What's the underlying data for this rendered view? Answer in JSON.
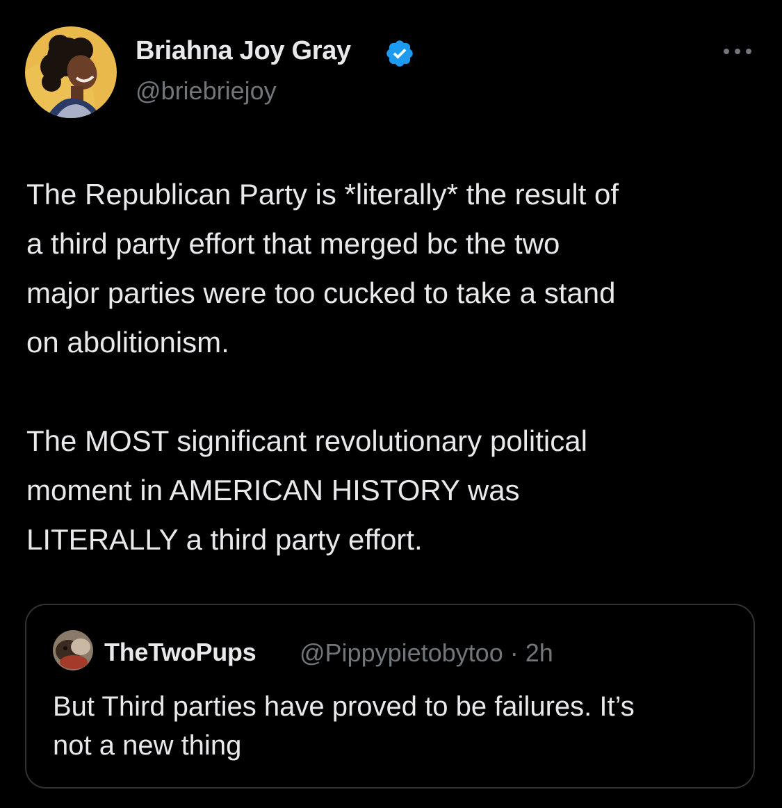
{
  "tweet": {
    "author": {
      "name": "Briahna Joy Gray",
      "handle": "@briebriejoy",
      "verified": true
    },
    "text_paragraph_1": "The Republican Party is *literally* the result of\na third party effort that merged bc the two\nmajor parties were too cucked to take a stand\non abolitionism.",
    "text_paragraph_2": "The MOST significant revolutionary political\nmoment in AMERICAN HISTORY was\nLITERALLY a third party effort.",
    "quoted_tweet": {
      "name": "TheTwoPups",
      "meta": "@Pippypietobytoo · 2h",
      "text": "But Third parties have proved to be failures. It’s\nnot a new thing"
    }
  },
  "icons": {
    "verified": "verified-badge-icon",
    "more": "more-options-icon"
  },
  "colors": {
    "background": "#000000",
    "text_primary": "#e7e9ea",
    "text_secondary": "#71767b",
    "border": "#2f3336",
    "verified_blue": "#1d9bf0",
    "avatar_bg": "#e8b94a"
  }
}
